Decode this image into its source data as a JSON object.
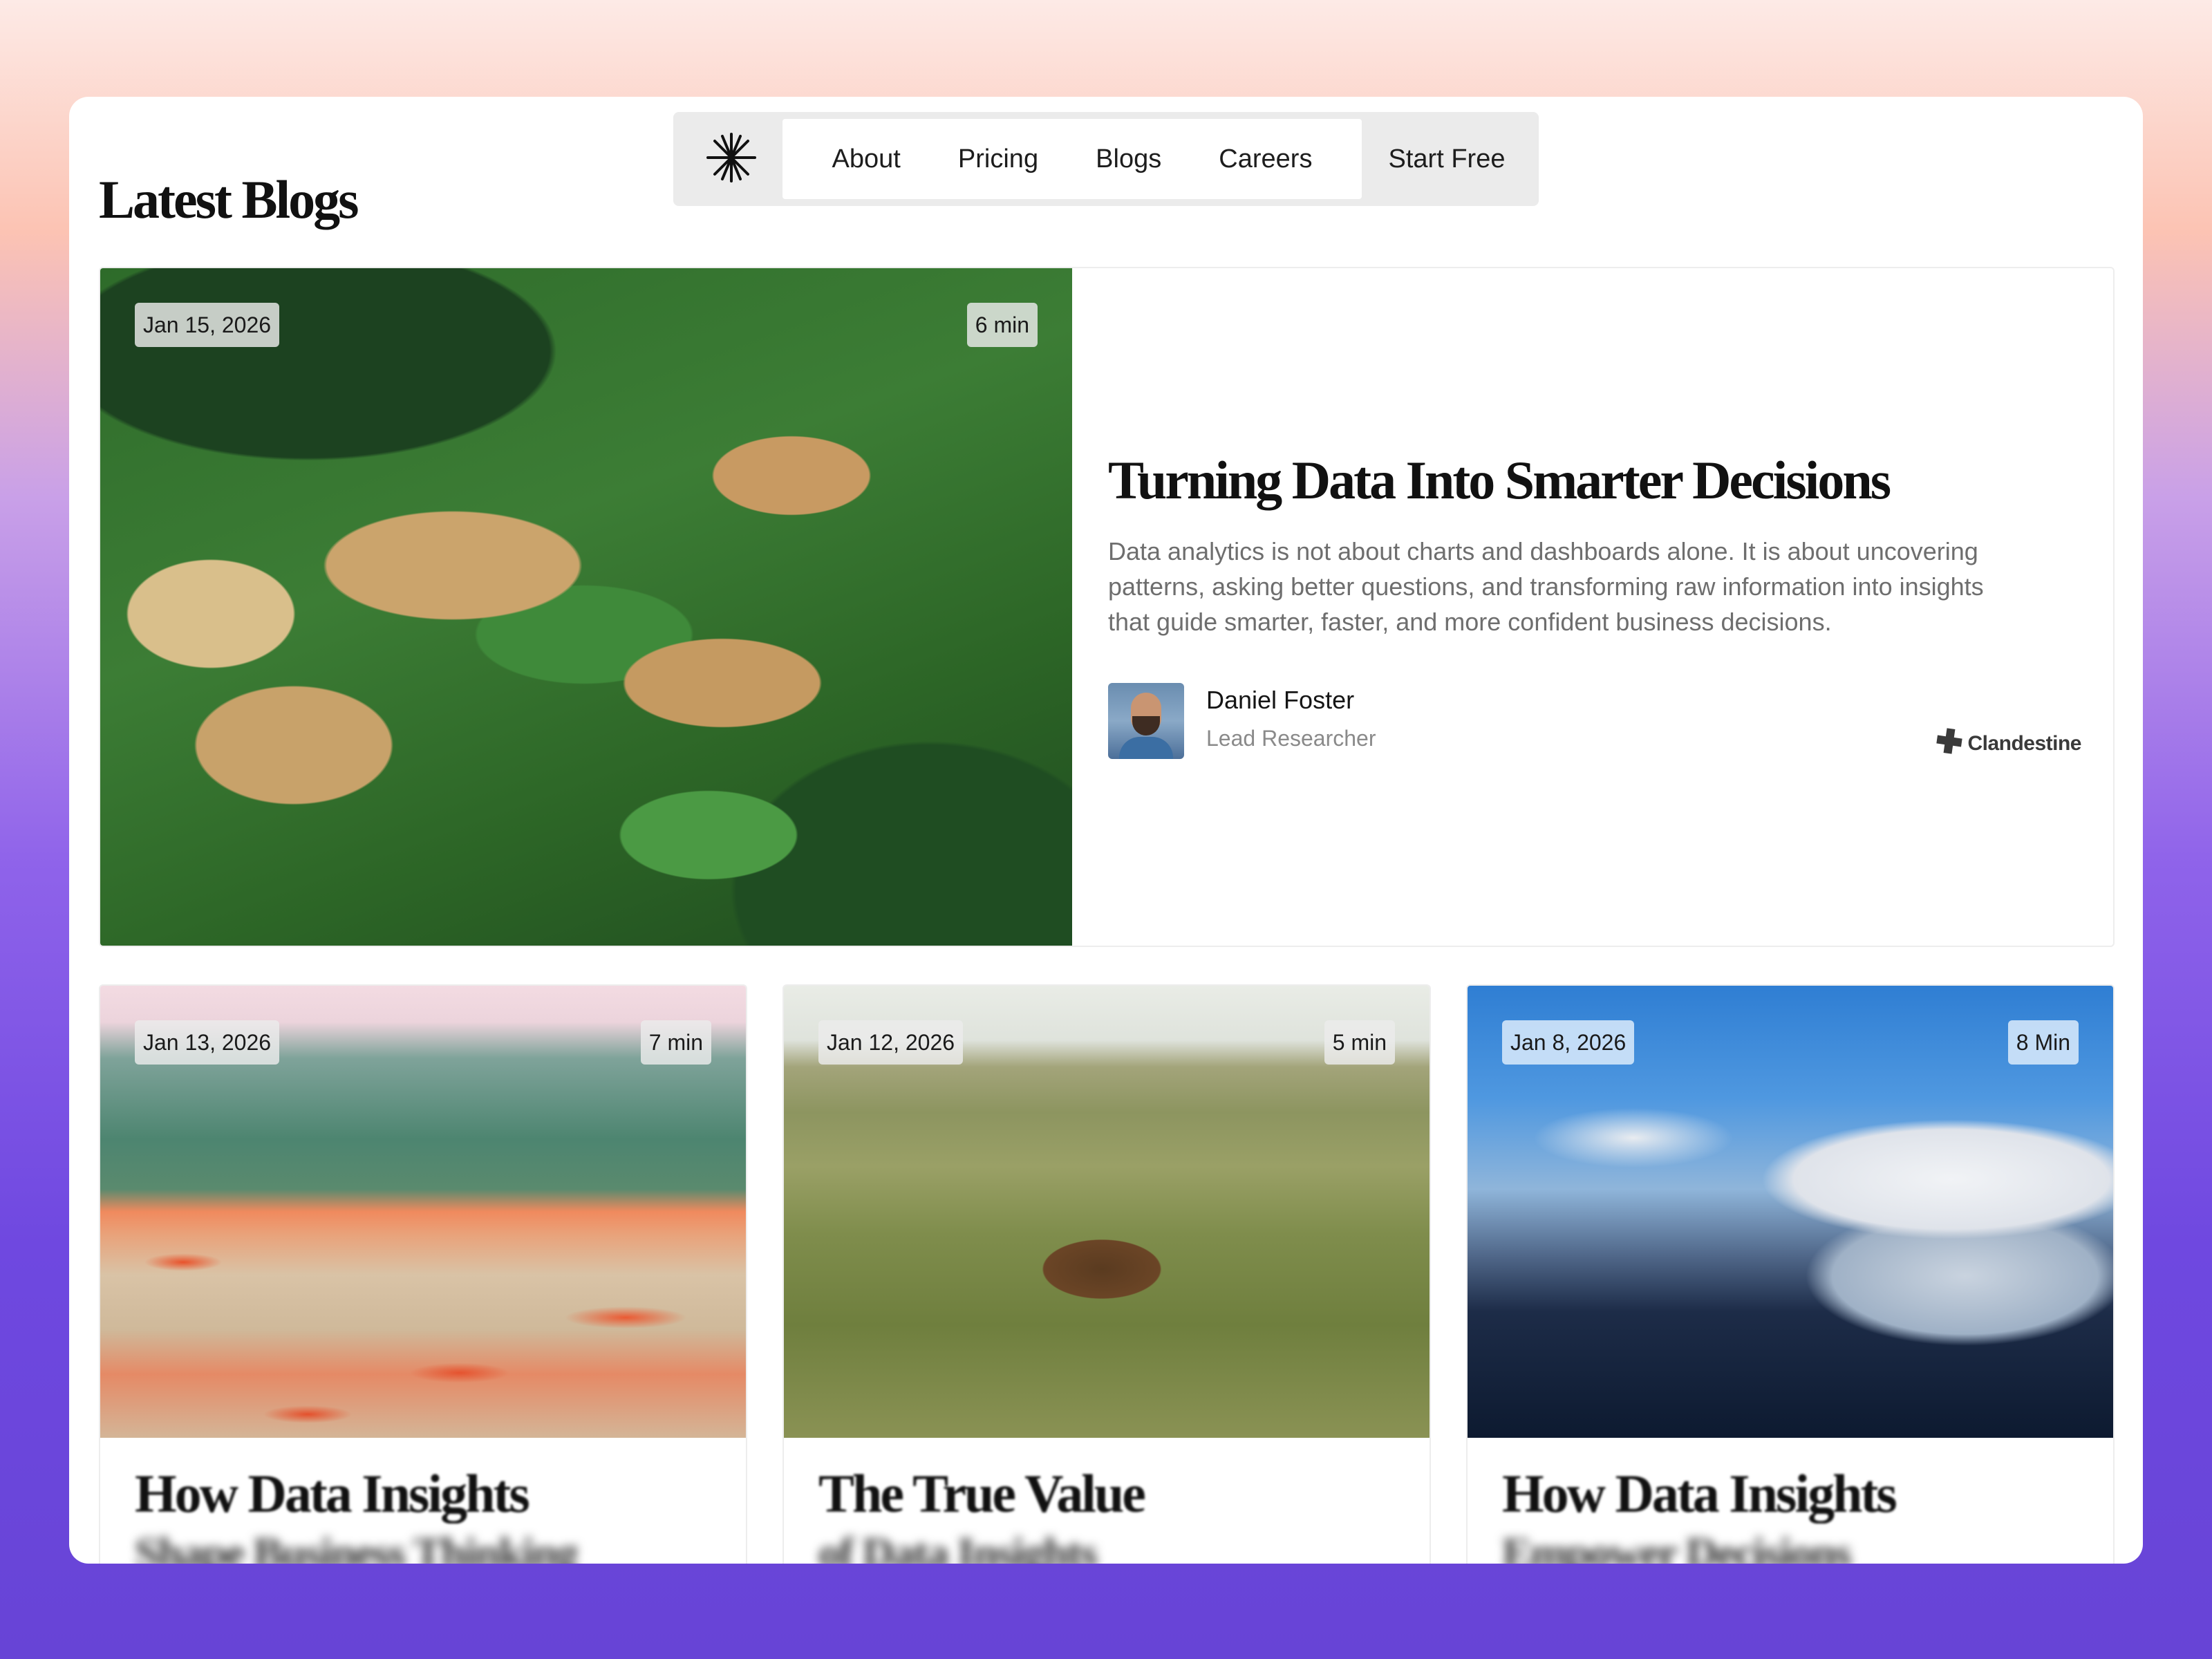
{
  "page": {
    "title": "Latest Blogs"
  },
  "nav": {
    "logo_icon": "asterisk-icon",
    "links": [
      "About",
      "Pricing",
      "Blogs",
      "Careers"
    ],
    "cta": "Start Free"
  },
  "featured": {
    "date": "Jan 15, 2026",
    "read_time": "6 min",
    "title": "Turning Data Into Smarter Decisions",
    "excerpt": "Data analytics is not about charts and dashboards alone. It is about uncovering patterns, asking better questions, and transforming raw information into insights that guide smarter, faster, and more confident business decisions.",
    "author": {
      "name": "Daniel Foster",
      "role": "Lead Researcher"
    },
    "brand": {
      "name": "Clandestine",
      "icon": "plus-cross-icon"
    }
  },
  "cards": [
    {
      "date": "Jan 13, 2026",
      "read_time": "7 min",
      "title": "How Data Insights",
      "subtitle": "Shape Business Thinking"
    },
    {
      "date": "Jan 12, 2026",
      "read_time": "5 min",
      "title": "The True Value",
      "subtitle": "of Data Insights"
    },
    {
      "date": "Jan 8, 2026",
      "read_time": "8 Min",
      "title": "How Data Insights",
      "subtitle": "Empower Decisions"
    }
  ]
}
